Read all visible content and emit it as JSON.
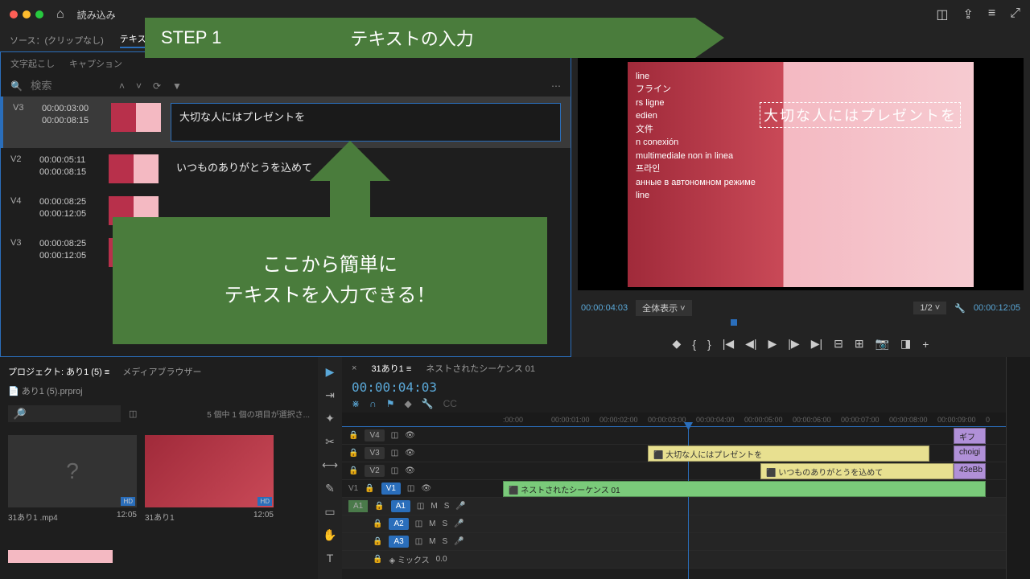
{
  "topbar": {
    "title": "読み込み"
  },
  "subbar": {
    "source": "ソース：(クリップなし)",
    "text_tab": "テキスト"
  },
  "lp": {
    "tab1": "文字起こし",
    "tab2": "キャプション",
    "search_placeholder": "検索"
  },
  "captions": [
    {
      "track": "V3",
      "in": "00:00:03:00",
      "out": "00:00:08:15",
      "text": "大切な人にはプレゼントを"
    },
    {
      "track": "V2",
      "in": "00:00:05:11",
      "out": "00:00:08:15",
      "text": "いつものありがとうを込めて"
    },
    {
      "track": "V4",
      "in": "00:00:08:25",
      "out": "00:00:12:05",
      "text": ""
    },
    {
      "track": "V3",
      "in": "00:00:08:25",
      "out": "00:00:12:05",
      "text": ""
    }
  ],
  "preview": {
    "lines": [
      "line",
      "フライン",
      "rs ligne",
      "edien",
      "文件",
      "n conexión",
      "multimediale non in linea",
      "프라인",
      "анные в автономном режиме",
      "line"
    ],
    "overlay_text": "大切な人にはプレゼントを",
    "timecode": "00:00:04:03",
    "fit": "全体表示",
    "zoom": "1/2",
    "duration": "00:00:12:05"
  },
  "project": {
    "tab1": "プロジェクト: あり1 (5)",
    "tab2": "メディアブラウザー",
    "file": "あり1 (5).prproj",
    "status": "5 個中 1 個の項目が選択さ...",
    "item1_name": "31あり1 .mp4",
    "item1_dur": "12:05",
    "item2_name": "31あり1",
    "item2_dur": "12:05"
  },
  "timeline": {
    "seq1": "31あり1",
    "seq2": "ネストされたシーケンス 01",
    "timecode": "00:00:04:03",
    "ruler": [
      ":00:00",
      "00:00:01:00",
      "00:00:02:00",
      "00:00:03:00",
      "00:00:04:00",
      "00:00:05:00",
      "00:00:06:00",
      "00:00:07:00",
      "00:00:08:00",
      "00:00:09:00",
      "0"
    ],
    "tracks_v": [
      "V4",
      "V3",
      "V2",
      "V1"
    ],
    "tracks_a": [
      "A1",
      "A2",
      "A3"
    ],
    "mix": "ミックス",
    "mix_val": "0.0",
    "clips": {
      "gif": "ギフ",
      "choi": "choigi",
      "hex": "43eBb",
      "c1": "大切な人にはプレゼントを",
      "c2": "いつものありがとうを込めて",
      "nest": "ネストされたシーケンス 01"
    }
  },
  "anno": {
    "step": "STEP 1",
    "step_title": "テキストの入力",
    "box1": "ここから簡単に",
    "box2": "テキストを入力できる！"
  }
}
